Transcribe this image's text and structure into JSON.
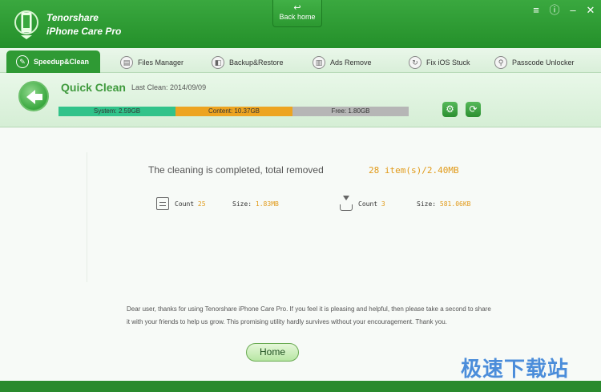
{
  "app": {
    "brand_line1": "Tenorshare",
    "brand_line2": "iPhone Care Pro",
    "back_home": "Back home"
  },
  "tabs": [
    {
      "label": "Speedup&Clean",
      "icon": "broom-icon",
      "active": true
    },
    {
      "label": "Files Manager",
      "icon": "files-icon"
    },
    {
      "label": "Backup&Restore",
      "icon": "backup-icon"
    },
    {
      "label": "Ads Remove",
      "icon": "ads-icon"
    },
    {
      "label": "Fix iOS Stuck",
      "icon": "fix-icon"
    },
    {
      "label": "Passcode Unlocker",
      "icon": "key-icon"
    }
  ],
  "quick_clean": {
    "title": "Quick Clean",
    "last_clean": "Last Clean: 2014/09/09",
    "storage": {
      "system": "System: 2.59GB",
      "content": "Content: 10.37GB",
      "free": "Free: 1.80GB"
    }
  },
  "result": {
    "completed_text": "The cleaning is completed, total removed",
    "total": "28 item(s)/2.40MB",
    "left": {
      "count_label": "Count",
      "count": "25",
      "size_label": "Size:",
      "size": "1.83MB"
    },
    "right": {
      "count_label": "Count",
      "count": "3",
      "size_label": "Size:",
      "size": "581.06KB"
    }
  },
  "note": "Dear user, thanks for using Tenorshare iPhone Care Pro. If you feel it is pleasing and helpful, then please take a second to share it with your friends to help us grow. This promising utility hardly survives without your encouragement. Thank you.",
  "home_button": "Home",
  "watermark": "极速下载站"
}
